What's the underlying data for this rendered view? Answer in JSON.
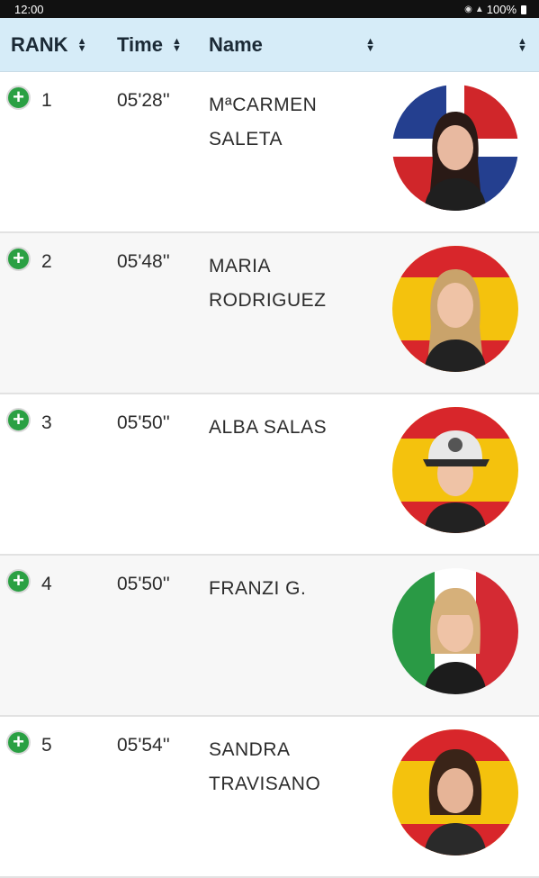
{
  "status_bar": {
    "time": "12:00",
    "battery": "100%"
  },
  "table": {
    "columns": {
      "rank": "RANK",
      "time": "Time",
      "name": "Name"
    },
    "rows": [
      {
        "rank": "1",
        "time": "05'28''",
        "name": "MªCARMEN SALETA",
        "flag": "dominican-republic-flag"
      },
      {
        "rank": "2",
        "time": "05'48''",
        "name": "MARIA RODRIGUEZ",
        "flag": "spain-flag"
      },
      {
        "rank": "3",
        "time": "05'50''",
        "name": "ALBA SALAS",
        "flag": "spain-flag"
      },
      {
        "rank": "4",
        "time": "05'50''",
        "name": "FRANZI G.",
        "flag": "italy-flag"
      },
      {
        "rank": "5",
        "time": "05'54''",
        "name": "SANDRA TRAVISANO",
        "flag": "spain-flag"
      }
    ]
  },
  "colors": {
    "header_background": "#d6ecf8",
    "expand_button": "#2aa043"
  }
}
